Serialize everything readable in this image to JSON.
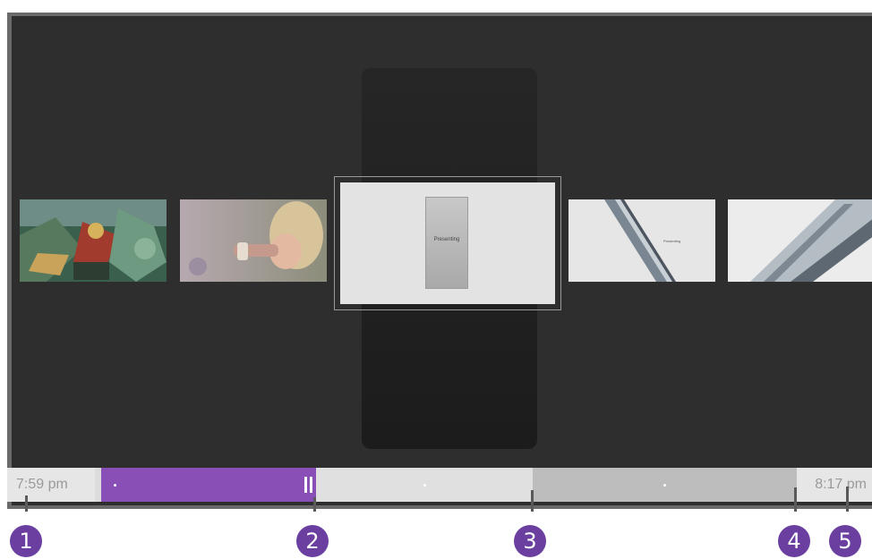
{
  "timeline": {
    "start_time": "7:59 pm",
    "end_time": "8:17 pm",
    "state": "paused"
  },
  "preview": {
    "selected_caption": "Presenting",
    "thumb4_caption": "Presenting"
  },
  "callouts": [
    "1",
    "2",
    "3",
    "4",
    "5"
  ],
  "colors": {
    "played": "#8a4fb7",
    "callout": "#6b3fa0",
    "background": "#2e2e2e"
  },
  "icons": {
    "pause": "pause-icon"
  }
}
